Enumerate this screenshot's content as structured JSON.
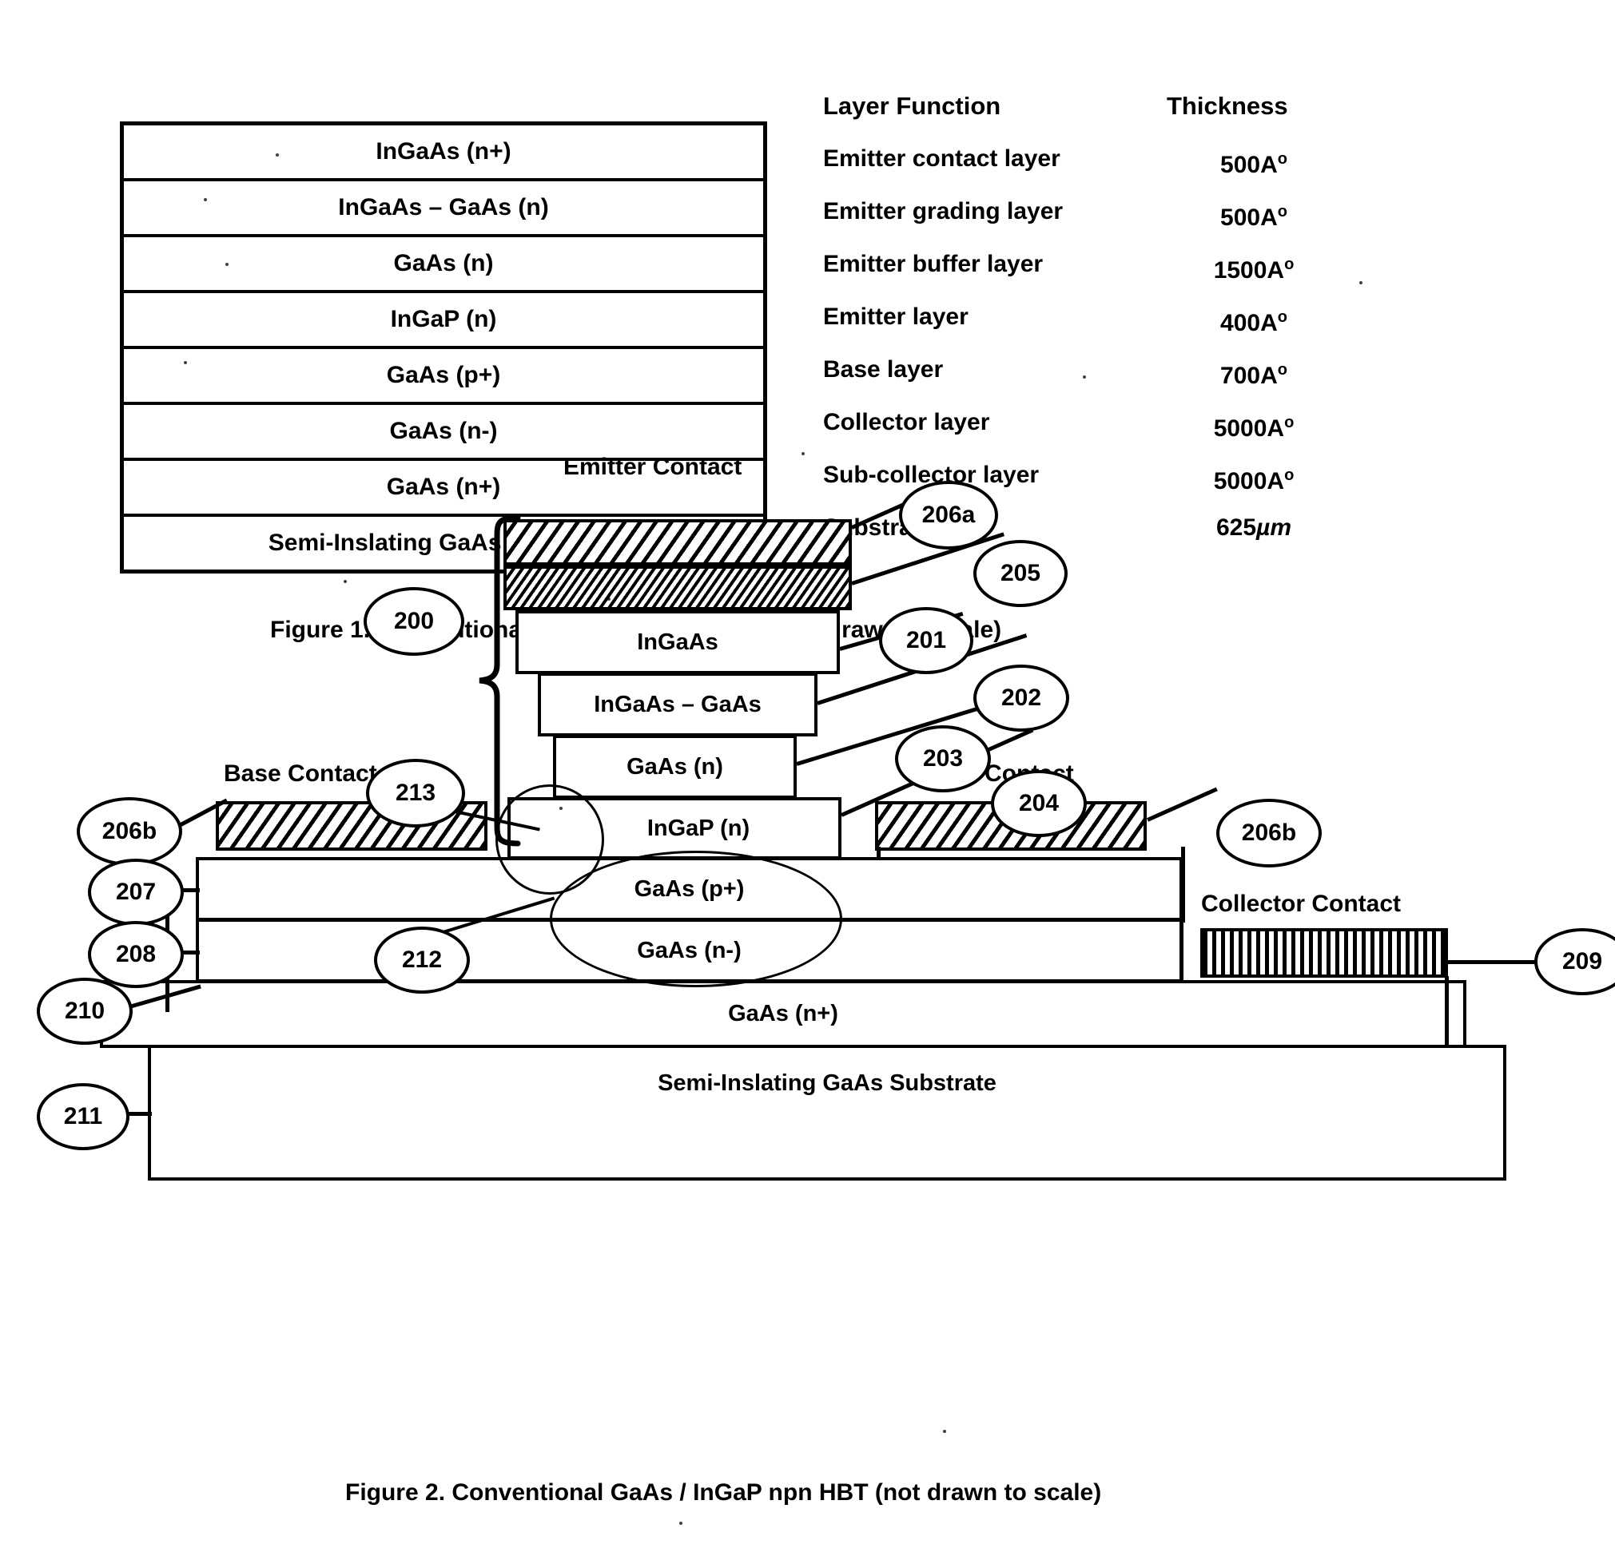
{
  "figure1": {
    "stack_layers": [
      "InGaAs (n+)",
      "InGaAs – GaAs (n)",
      "GaAs (n)",
      "InGaP (n)",
      "GaAs (p+)",
      "GaAs (n-)",
      "GaAs (n+)",
      "Semi-Inslating GaAs Substrate"
    ],
    "columns": {
      "function_header": "Layer Function",
      "thickness_header": "Thickness"
    },
    "functions": [
      "Emitter contact layer",
      "Emitter grading layer",
      "Emitter buffer layer",
      "Emitter layer",
      "Base layer",
      "Collector layer",
      "Sub-collector layer",
      "Substrate"
    ],
    "thicknesses": [
      "500A",
      "500A",
      "1500A",
      "400A",
      "700A",
      "5000A",
      "5000A",
      "625"
    ],
    "thickness_units": [
      "o",
      "o",
      "o",
      "o",
      "o",
      "o",
      "o",
      "µm"
    ],
    "caption": "Figure 1. Conventional HBT Layer Structure (not drawn to scale)"
  },
  "figure2": {
    "caption": "Figure 2. Conventional GaAs / InGaP npn HBT (not drawn to scale)",
    "labels": {
      "emitter_contact": "Emitter Contact",
      "base_contact_left": "Base Contact",
      "base_contact_right": "Base Contact",
      "collector_contact": "Collector Contact"
    },
    "layers": {
      "ingaas": "InGaAs",
      "ingaas_gaas": "InGaAs – GaAs",
      "gaas_n": "GaAs (n)",
      "ingap_n": "InGaP (n)",
      "gaas_pplus": "GaAs (p+)",
      "gaas_nminus": "GaAs (n-)",
      "gaas_nplus": "GaAs (n+)",
      "substrate": "Semi-Inslating GaAs Substrate"
    },
    "callouts": {
      "c200": "200",
      "c201": "201",
      "c202": "202",
      "c203": "203",
      "c204": "204",
      "c205": "205",
      "c206a": "206a",
      "c206b_left": "206b",
      "c206b_right": "206b",
      "c207": "207",
      "c208": "208",
      "c209": "209",
      "c210": "210",
      "c211": "211",
      "c212": "212",
      "c213": "213"
    }
  },
  "colors": {
    "ink": "#000000",
    "paper": "#ffffff"
  }
}
